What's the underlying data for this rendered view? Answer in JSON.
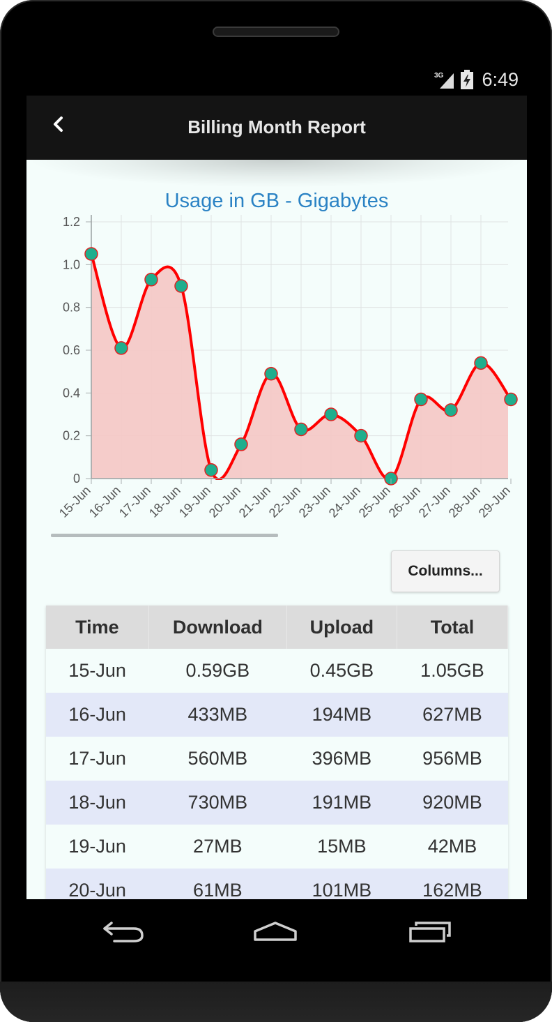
{
  "status_bar": {
    "network": "3G",
    "time": "6:49"
  },
  "header": {
    "title": "Billing Month Report"
  },
  "chart_data": {
    "type": "area",
    "title": "Usage in GB - Gigabytes",
    "xlabel": "",
    "ylabel": "",
    "ylim": [
      0,
      1.2
    ],
    "yticks": [
      "0",
      "0.2",
      "0.4",
      "0.6",
      "0.8",
      "1.0",
      "1.2"
    ],
    "grid": true,
    "categories": [
      "15-Jun",
      "16-Jun",
      "17-Jun",
      "18-Jun",
      "19-Jun",
      "20-Jun",
      "21-Jun",
      "22-Jun",
      "23-Jun",
      "24-Jun",
      "25-Jun",
      "26-Jun",
      "27-Jun",
      "28-Jun",
      "29-Jun"
    ],
    "values": [
      1.05,
      0.61,
      0.93,
      0.9,
      0.04,
      0.16,
      0.49,
      0.23,
      0.3,
      0.2,
      0.0,
      0.37,
      0.32,
      0.54,
      0.37
    ],
    "colors": {
      "line": "#ff0000",
      "fill": "#f5c6c4",
      "marker": "#1fae8d",
      "marker_stroke": "#e32020",
      "grid": "#dfe3e3",
      "title": "#2a82c4"
    }
  },
  "columns_button": {
    "label": "Columns..."
  },
  "table": {
    "headers": [
      "Time",
      "Download",
      "Upload",
      "Total"
    ],
    "rows": [
      [
        "15-Jun",
        "0.59GB",
        "0.45GB",
        "1.05GB"
      ],
      [
        "16-Jun",
        "433MB",
        "194MB",
        "627MB"
      ],
      [
        "17-Jun",
        "560MB",
        "396MB",
        "956MB"
      ],
      [
        "18-Jun",
        "730MB",
        "191MB",
        "920MB"
      ],
      [
        "19-Jun",
        "27MB",
        "15MB",
        "42MB"
      ],
      [
        "20-Jun",
        "61MB",
        "101MB",
        "162MB"
      ]
    ]
  },
  "nav_bar": {
    "icons": [
      "back-icon",
      "home-icon",
      "recent-apps-icon"
    ]
  }
}
